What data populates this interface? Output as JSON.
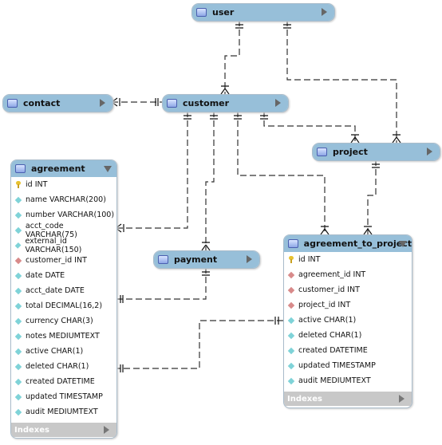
{
  "tables": {
    "user": {
      "name": "user"
    },
    "contact": {
      "name": "contact"
    },
    "customer": {
      "name": "customer"
    },
    "project": {
      "name": "project"
    },
    "payment": {
      "name": "payment"
    },
    "agreement": {
      "name": "agreement",
      "indexes_label": "Indexes",
      "columns": [
        {
          "label": "id INT",
          "key": "pk"
        },
        {
          "label": "name VARCHAR(200)",
          "key": "col"
        },
        {
          "label": "number VARCHAR(100)",
          "key": "col"
        },
        {
          "label": "acct_code VARCHAR(75)",
          "key": "col"
        },
        {
          "label": "external_id VARCHAR(150)",
          "key": "col"
        },
        {
          "label": "customer_id INT",
          "key": "fk"
        },
        {
          "label": "date DATE",
          "key": "col"
        },
        {
          "label": "acct_date DATE",
          "key": "col"
        },
        {
          "label": "total DECIMAL(16,2)",
          "key": "col"
        },
        {
          "label": "currency CHAR(3)",
          "key": "col"
        },
        {
          "label": "notes MEDIUMTEXT",
          "key": "col"
        },
        {
          "label": "active CHAR(1)",
          "key": "col"
        },
        {
          "label": "deleted CHAR(1)",
          "key": "col"
        },
        {
          "label": "created DATETIME",
          "key": "col"
        },
        {
          "label": "updated TIMESTAMP",
          "key": "col"
        },
        {
          "label": "audit MEDIUMTEXT",
          "key": "col"
        }
      ]
    },
    "agreement_to_project": {
      "name": "agreement_to_project",
      "indexes_label": "Indexes",
      "columns": [
        {
          "label": "id INT",
          "key": "pk"
        },
        {
          "label": "agreement_id INT",
          "key": "fk"
        },
        {
          "label": "customer_id INT",
          "key": "fk"
        },
        {
          "label": "project_id INT",
          "key": "fk"
        },
        {
          "label": "active CHAR(1)",
          "key": "col"
        },
        {
          "label": "deleted CHAR(1)",
          "key": "col"
        },
        {
          "label": "created DATETIME",
          "key": "col"
        },
        {
          "label": "updated TIMESTAMP",
          "key": "col"
        },
        {
          "label": "audit MEDIUMTEXT",
          "key": "col"
        }
      ]
    }
  },
  "colors": {
    "header": "#97bfd9",
    "pk": "#e8c230",
    "fk": "#d88a8a",
    "column": "#7fd3d8",
    "line": "#333333"
  }
}
